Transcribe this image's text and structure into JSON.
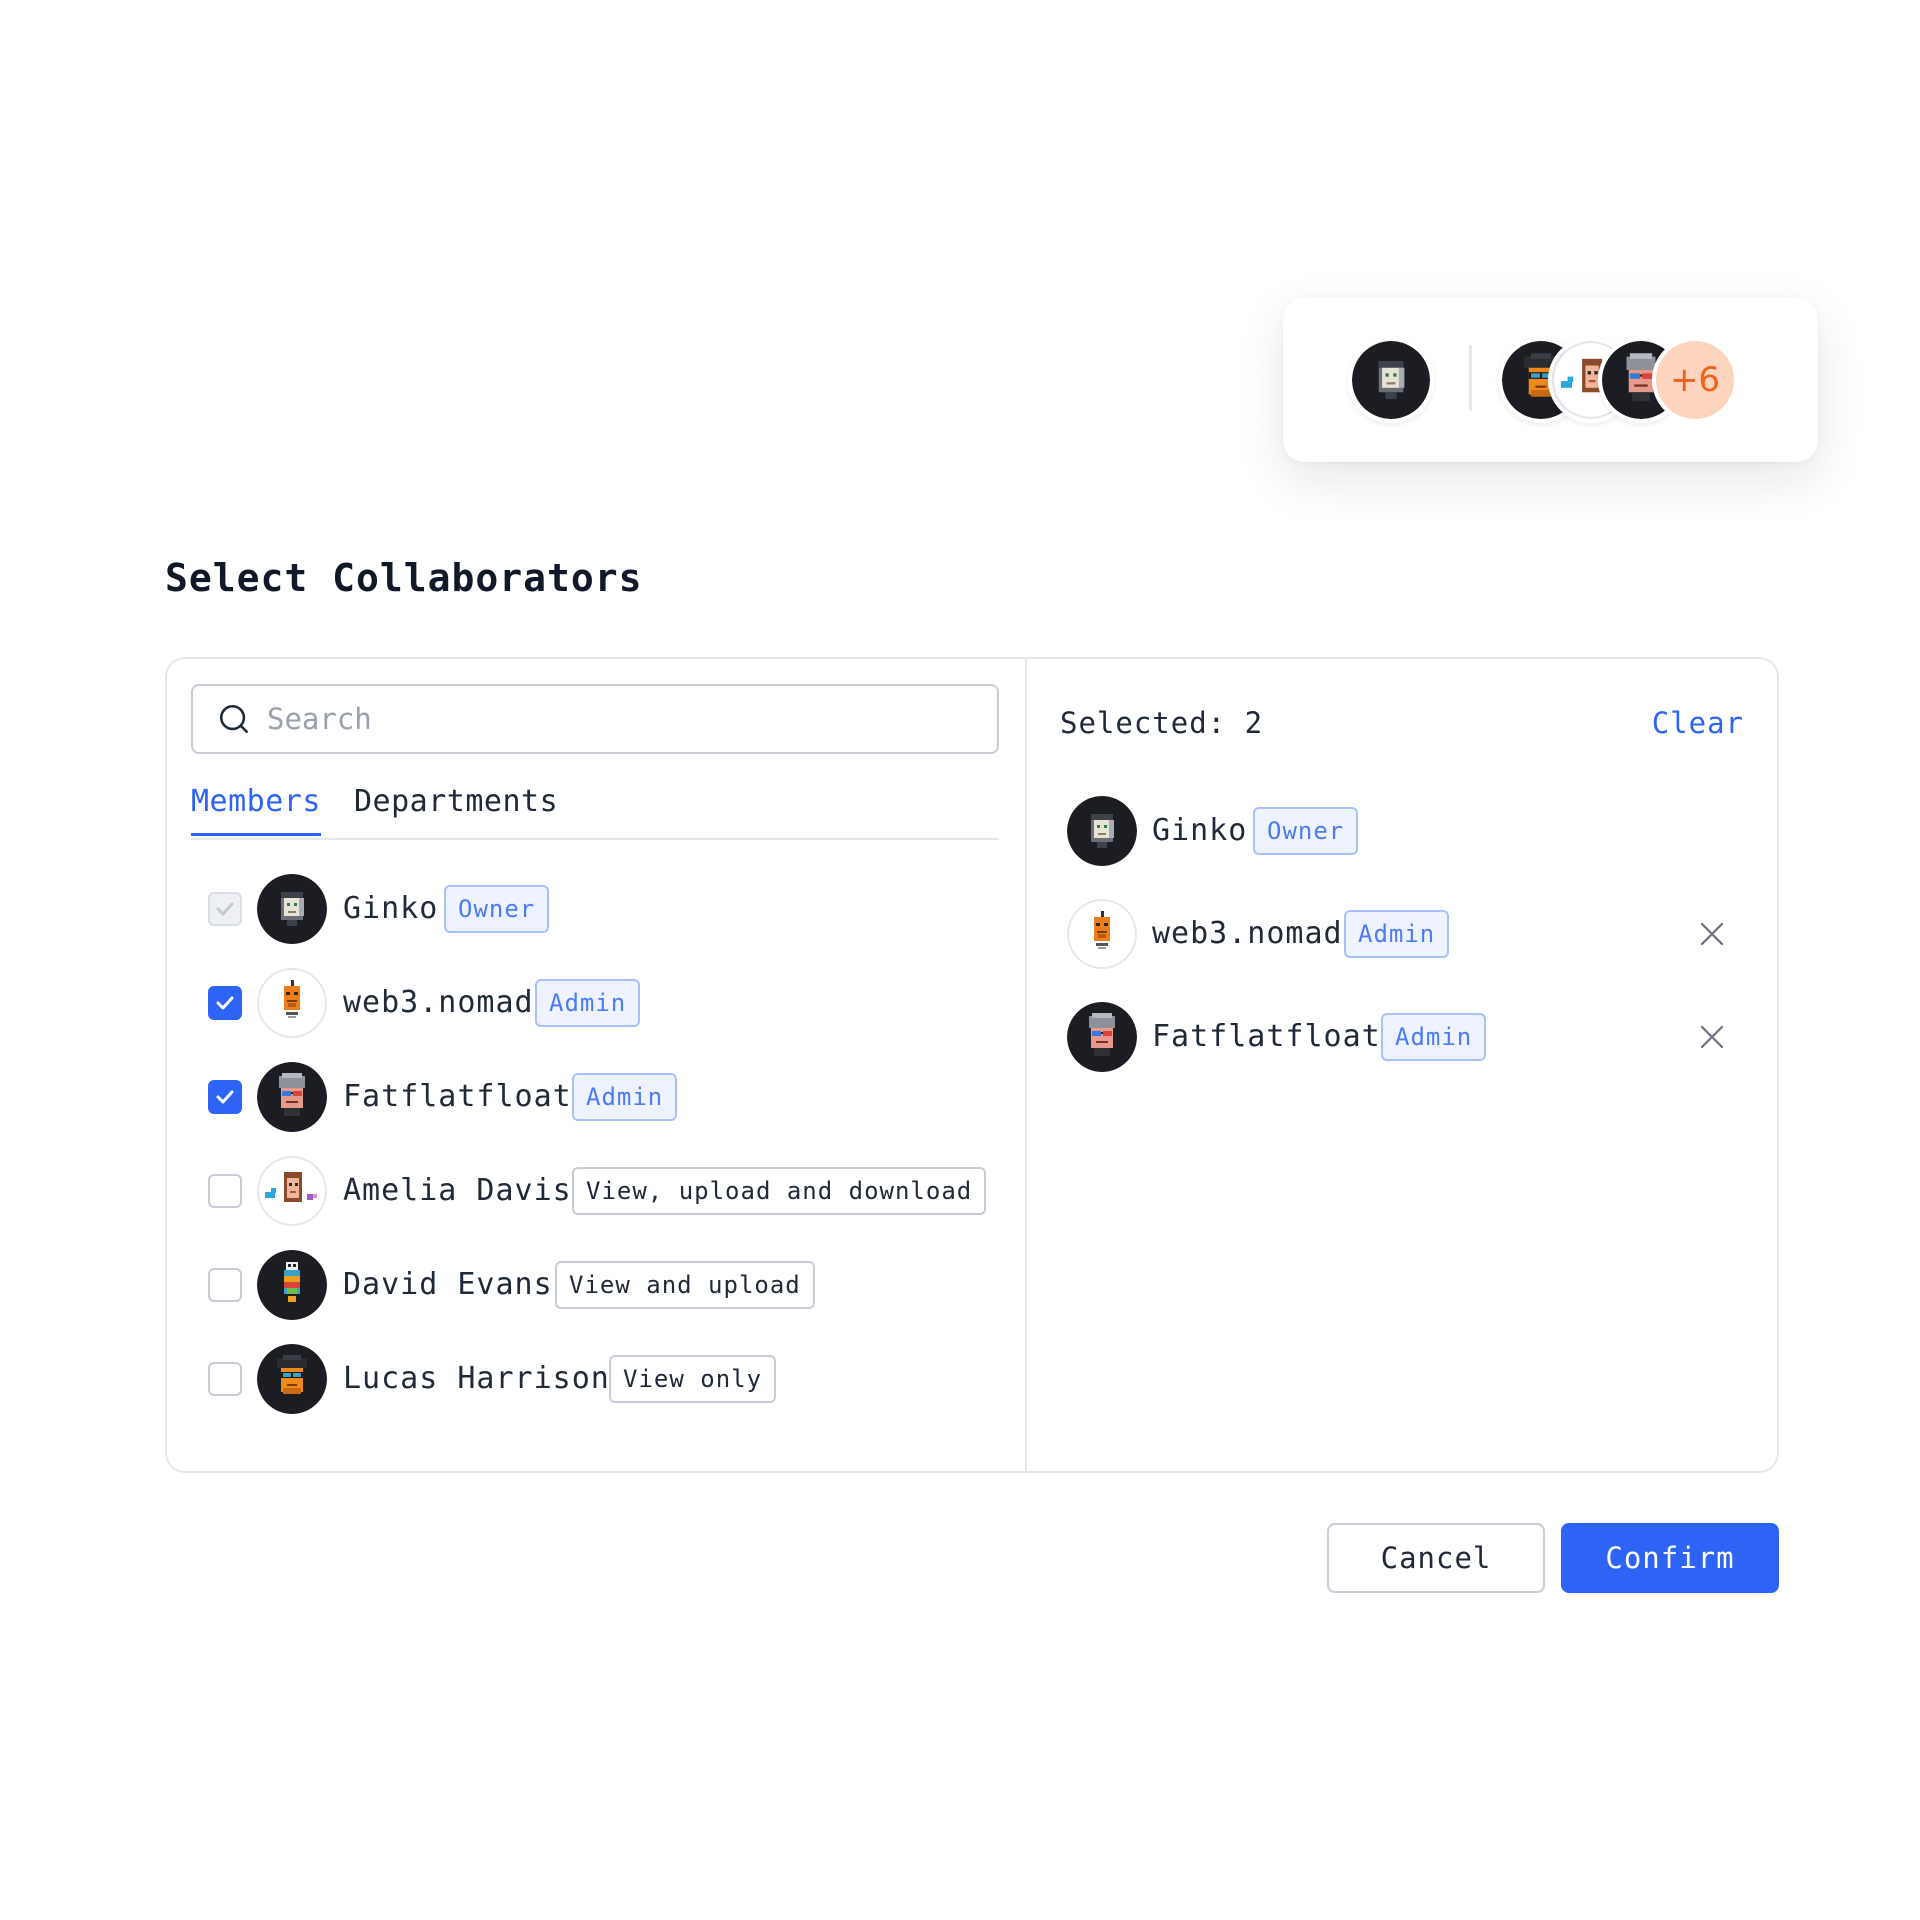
{
  "avatar_stack": {
    "owner_avatar": "ginko-avatar",
    "group_avatars": [
      "lucas-harrison-avatar",
      "amelia-davis-avatar",
      "fatflatfloat-avatar"
    ],
    "more_count": "+6"
  },
  "title": "Select Collaborators",
  "search": {
    "placeholder": "Search",
    "icon": "search-icon"
  },
  "tabs": [
    {
      "label": "Members",
      "active": true
    },
    {
      "label": "Departments",
      "active": false
    }
  ],
  "members": [
    {
      "name": "Ginko",
      "role": "Owner",
      "role_style": "blue",
      "checked": true,
      "disabled": true
    },
    {
      "name": "web3.nomad",
      "role": "Admin",
      "role_style": "blue",
      "checked": true,
      "disabled": false
    },
    {
      "name": "Fatflatfloat",
      "role": "Admin",
      "role_style": "blue",
      "checked": true,
      "disabled": false
    },
    {
      "name": "Amelia Davis",
      "role": "View, upload and download",
      "role_style": "gray",
      "checked": false,
      "disabled": false
    },
    {
      "name": "David Evans",
      "role": "View and upload",
      "role_style": "gray",
      "checked": false,
      "disabled": false
    },
    {
      "name": "Lucas Harrison",
      "role": "View only",
      "role_style": "gray",
      "checked": false,
      "disabled": false
    }
  ],
  "selected_panel": {
    "label": "Selected: 2",
    "clear_label": "Clear",
    "items": [
      {
        "name": "Ginko",
        "role": "Owner",
        "removable": false
      },
      {
        "name": "web3.nomad",
        "role": "Admin",
        "removable": true
      },
      {
        "name": "Fatflatfloat",
        "role": "Admin",
        "removable": true
      }
    ]
  },
  "buttons": {
    "cancel": "Cancel",
    "confirm": "Confirm"
  },
  "colors": {
    "accent": "#2e64f5",
    "badge_blue_bg": "#eef3ff",
    "more_bg": "#fdd5be",
    "more_text": "#f0611c"
  }
}
